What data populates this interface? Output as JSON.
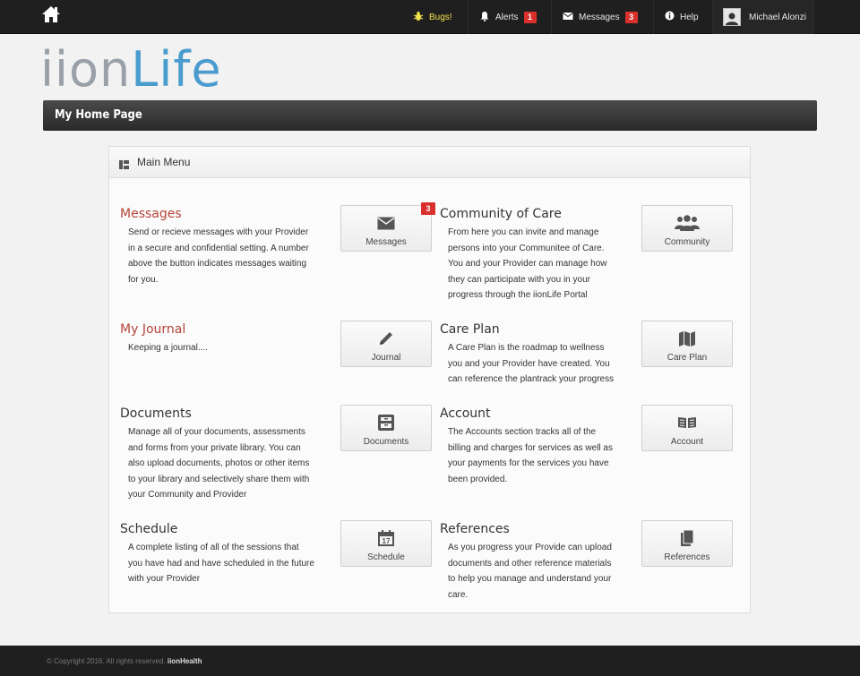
{
  "topbar": {
    "bugs": "Bugs!",
    "alerts": "Alerts",
    "alerts_count": "1",
    "messages": "Messages",
    "messages_count": "3",
    "help": "Help",
    "user": "Michael Alonzi"
  },
  "logo": {
    "part1": "ii",
    "part2": "on",
    "part3": "Life"
  },
  "page_title": "My Home Page",
  "panel": {
    "title": "Main Menu",
    "sections": [
      {
        "title": "Messages",
        "desc": [
          "Send or recieve messages with your Provider",
          "in a secure and confidential setting. A number",
          "above the button indicates messages waiting",
          "for you."
        ],
        "button": "Messages",
        "badge": "3"
      },
      {
        "title": "Community of Care",
        "desc": [
          "From here you can invite and manage",
          "persons into your Communitee of Care.",
          "You and your Provider can manage how",
          "they can participate with you in your",
          "progress through the iionLife Portal"
        ],
        "button": "Community"
      },
      {
        "title": "My Journal",
        "desc": [
          "Keeping a journal...."
        ],
        "button": "Journal"
      },
      {
        "title": "Care Plan",
        "desc": [
          "A Care Plan is the roadmap to wellness",
          "you and your Provider have created. You",
          "can reference the plantrack your progress"
        ],
        "button": "Care Plan"
      },
      {
        "title": "Documents",
        "desc": [
          "Manage all of your documents, assessments",
          "and forms from your private library. You can",
          "also upload documents, photos or other items",
          "to your library and selectively share them with",
          "your Community and Provider"
        ],
        "button": "Documents"
      },
      {
        "title": "Account",
        "desc": [
          "The Accounts section tracks all of the",
          "billing and charges for services as well as",
          "your payments for the services you have",
          "been provided."
        ],
        "button": "Account"
      },
      {
        "title": "Schedule",
        "desc": [
          "A complete listing of all of the sessions that",
          "you have had and have scheduled in the future",
          "with your Provider"
        ],
        "button": "Schedule",
        "icon_text": "17"
      },
      {
        "title": "References",
        "desc": [
          "As you progress your Provide can upload",
          "documents and other reference materials",
          "to help you manage and understand your",
          "care."
        ],
        "button": "References"
      }
    ]
  },
  "footer": {
    "copyright": "© Copyright 2016. All rights reserved.",
    "brand": "iionHealth"
  },
  "colors": {
    "accent_red": "#b5443a",
    "badge_red": "#d9302c",
    "logo_blue": "#4a9ccf",
    "logo_gray": "#9aa0a8",
    "bar_dark": "#1f1f1f"
  }
}
